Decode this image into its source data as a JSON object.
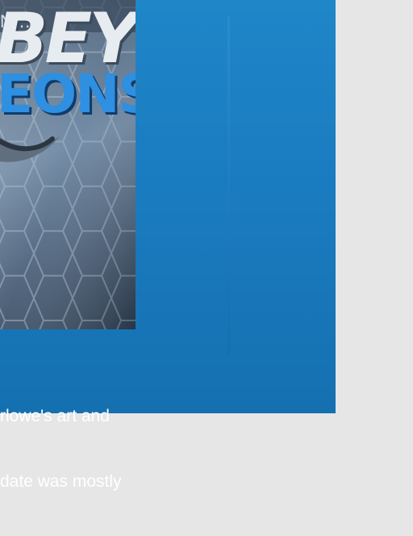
{
  "cover": {
    "word_top": "BEY",
    "word_bottom": "EONS",
    "corner_text": "N..."
  },
  "caption": {
    "line1": "rlowe's art and",
    "line2": "date was mostly"
  },
  "colors": {
    "blue_panel": "#1a7cc0",
    "side_panel": "#e6e6e6",
    "cover_text_blue": "#2f8fe0"
  }
}
